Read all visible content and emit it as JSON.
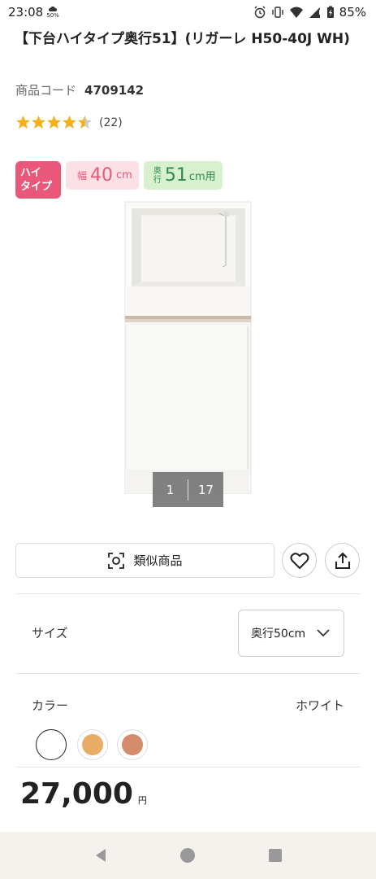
{
  "status_bar": {
    "time": "23:08",
    "data_saver": "50%",
    "battery": "85%",
    "icons": [
      "alarm-icon",
      "vibrate-icon",
      "wifi-icon",
      "signal-icon",
      "battery-icon"
    ]
  },
  "product": {
    "title": "【下台ハイタイプ奥行51】(リガーレ H50-40J WH)",
    "code_label": "商品コード",
    "code_value": "4709142",
    "rating": 4.5,
    "review_count": "(22)",
    "badges": {
      "type": "ハイ\nタイプ",
      "width_key": "幅",
      "width_value": "40",
      "width_unit": "cm",
      "depth_key": "奥行",
      "depth_value": "51",
      "depth_unit": "cm用"
    },
    "gallery": {
      "current": "1",
      "total": "17"
    }
  },
  "actions": {
    "similar_label": "類似商品",
    "favorite_icon": "heart-icon",
    "share_icon": "share-icon"
  },
  "size": {
    "label": "サイズ",
    "selected": "奥行50cm"
  },
  "color": {
    "label": "カラー",
    "selected": "ホワイト",
    "swatches": [
      "#ffffff",
      "#e8ac64",
      "#d58c6a"
    ]
  },
  "price": {
    "value": "27,000",
    "unit": "円"
  },
  "nav": {
    "icons": [
      "back-icon",
      "home-icon",
      "recents-icon"
    ]
  },
  "colors": {
    "accent_pink": "#e9577b",
    "depth_green": "#2c8a4f",
    "star": "#f3b21d"
  }
}
